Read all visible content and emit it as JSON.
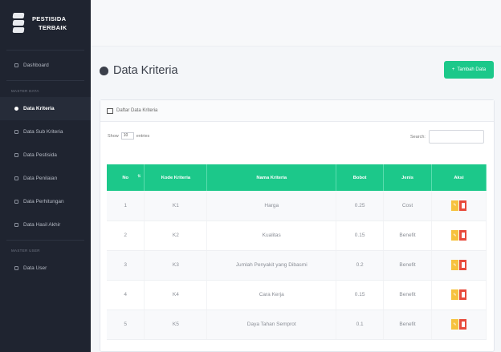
{
  "brand": {
    "line1": "PESTISIDA",
    "line2": "TERBAIK"
  },
  "sidebar": {
    "items_top": [
      {
        "label": "Dashboard"
      }
    ],
    "heading1": "MASTER DATA",
    "items_master": [
      {
        "label": "Data Kriteria",
        "active": true
      },
      {
        "label": "Data Sub Kriteria"
      },
      {
        "label": "Data Pestisida"
      },
      {
        "label": "Data Penilaian"
      },
      {
        "label": "Data Perhitungan"
      },
      {
        "label": "Data Hasil Akhir"
      }
    ],
    "heading2": "MASTER USER",
    "items_user": [
      {
        "label": "Data User"
      }
    ]
  },
  "page": {
    "title": "Data Kriteria",
    "add_button": "Tambah Data"
  },
  "card": {
    "header": "Daftar Data Kriteria",
    "show_label": "Show",
    "show_value": "10",
    "entries_label": "entries",
    "search_label": "Search:",
    "columns": [
      "No",
      "Kode Kriteria",
      "Nama Kriteria",
      "Bobot",
      "Jenis",
      "Aksi"
    ],
    "rows": [
      {
        "no": "1",
        "kode": "K1",
        "nama": "Harga",
        "bobot": "0.25",
        "jenis": "Cost"
      },
      {
        "no": "2",
        "kode": "K2",
        "nama": "Kualitas",
        "bobot": "0.15",
        "jenis": "Benefit"
      },
      {
        "no": "3",
        "kode": "K3",
        "nama": "Jumlah Penyakit yang Dibasmi",
        "bobot": "0.2",
        "jenis": "Benefit"
      },
      {
        "no": "4",
        "kode": "K4",
        "nama": "Cara Kerja",
        "bobot": "0.15",
        "jenis": "Benefit"
      },
      {
        "no": "5",
        "kode": "K5",
        "nama": "Daya Tahan Semprot",
        "bobot": "0.1",
        "jenis": "Benefit"
      }
    ]
  },
  "colors": {
    "sidebar_bg": "#1f2430",
    "accent_green": "#1cc88a",
    "edit_yellow": "#f6c23e",
    "delete_red": "#e74a3b"
  }
}
